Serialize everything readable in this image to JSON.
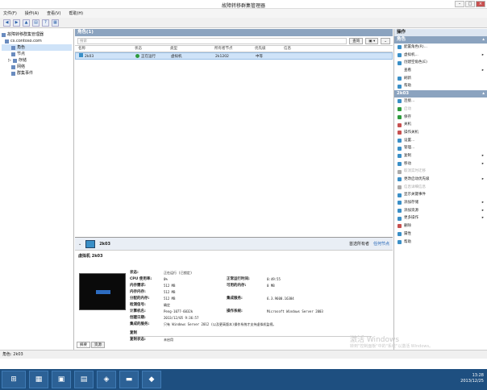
{
  "window": {
    "title": "故障转移群集管理器"
  },
  "menu": [
    "文件(F)",
    "操作(A)",
    "查看(V)",
    "帮助(H)"
  ],
  "tree": {
    "root": "故障转移群集管理器",
    "cluster": "cs.contoso.com",
    "items": [
      "角色",
      "节点",
      "存储",
      "网络",
      "群集事件"
    ]
  },
  "roles": {
    "header": "角色(1)",
    "search_placeholder": "搜索",
    "query_label": "查询",
    "columns": [
      "名称",
      "状态",
      "类型",
      "所有者节点",
      "优先级",
      "信息"
    ],
    "rows": [
      {
        "name": "2k03",
        "status": "正在运行",
        "type": "虚拟机",
        "owner": "2k1202",
        "priority": "中等",
        "info": ""
      }
    ]
  },
  "detail": {
    "name": "2k03",
    "pref_owners_label": "首选所有者",
    "any_node_label": "任何节点",
    "subheader": "虚拟机 2k03",
    "props_left": [
      {
        "k": "状态:",
        "v": "正在运行 (已锁定)"
      },
      {
        "k": "CPU 使用率:",
        "v": "0%"
      },
      {
        "k": "内存需求:",
        "v": "512 MB"
      },
      {
        "k": "内存内存:",
        "v": "512 MB"
      },
      {
        "k": "分配的内存:",
        "v": "512 MB"
      },
      {
        "k": "检测信号:",
        "v": "确定"
      },
      {
        "k": "计算机名:",
        "v": "Peng-1077-6032k"
      },
      {
        "k": "创建日期:",
        "v": "2013/12/05 9:36:57"
      },
      {
        "k": "集成的服务:",
        "v": "只有 Windows Server 2012 (以及更高版本)操作系统才支持虚拟机监视。"
      }
    ],
    "props_right": [
      {
        "k": "正常运行时间:",
        "v": "0:49:55"
      },
      {
        "k": "可用的内存:",
        "v": "0 MB"
      },
      {
        "k": "集成服务:",
        "v": "6.3.9600.16384"
      },
      {
        "k": "操作系统:",
        "v": "Microsoft Windows Server 2003"
      }
    ],
    "replication_label": "复制",
    "replication_status_key": "复制状态:",
    "replication_status_val": "未启用",
    "tabs": [
      "摘要",
      "资源"
    ]
  },
  "actions": {
    "title": "操作",
    "section1": "角色",
    "items1": [
      "配置角色(R)...",
      "虚拟机...",
      "创建空角色(E)",
      "查看",
      "刷新",
      "帮助"
    ],
    "section2": "2k03",
    "items2": [
      "连接...",
      "启动",
      "保存",
      "关机",
      "操作关机",
      "设置...",
      "管理...",
      "复制",
      "移动",
      "取消实时迁移",
      "更改启动优先级",
      "信息详细信息",
      "显示关键事件",
      "添加存储",
      "添加资源",
      "更多操作",
      "删除",
      "属性",
      "帮助"
    ]
  },
  "status_bar": "角色: 2k03",
  "clock": {
    "time": "13:28",
    "date": "2013/12/25"
  },
  "watermark": {
    "line1": "激活 Windows",
    "line2": "转到\"控制面板\"中的\"系统\"以激活 Windows。"
  }
}
